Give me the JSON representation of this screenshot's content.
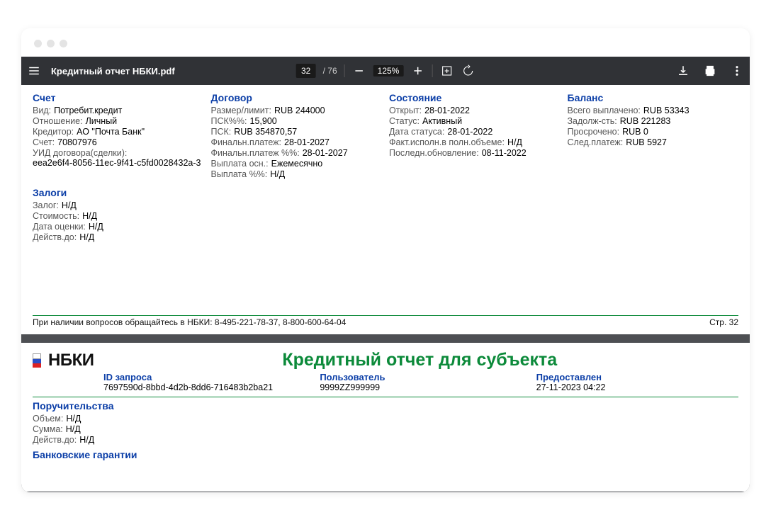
{
  "toolbar": {
    "filename": "Кредитный отчет НБКИ.pdf",
    "page_current": "32",
    "page_total": "/ 76",
    "zoom": "125%"
  },
  "page1": {
    "account": {
      "title": "Счет",
      "type_lbl": "Вид:",
      "type_val": "Потребит.кредит",
      "relation_lbl": "Отношение:",
      "relation_val": "Личный",
      "creditor_lbl": "Кредитор:",
      "creditor_val": "АО \"Почта Банк\"",
      "acct_lbl": "Счет:",
      "acct_val": "70807976",
      "uid_lbl": "УИД договора(сделки):",
      "uid_val": "eea2e6f4-8056-11ec-9f41-c5fd0028432a-3"
    },
    "contract": {
      "title": "Договор",
      "limit_lbl": "Размер/лимит:",
      "limit_val": "RUB 244000",
      "pskp_lbl": "ПСК%%:",
      "pskp_val": "15,900",
      "psk_lbl": "ПСК:",
      "psk_val": "RUB 354870,57",
      "final_lbl": "Финальн.платеж:",
      "final_val": "28-01-2027",
      "finalp_lbl": "Финальн.платеж %%:",
      "finalp_val": "28-01-2027",
      "payout_lbl": "Выплата осн.:",
      "payout_val": "Ежемесячно",
      "payoutp_lbl": "Выплата %%:",
      "payoutp_val": "Н/Д"
    },
    "state": {
      "title": "Состояние",
      "open_lbl": "Открыт:",
      "open_val": "28-01-2022",
      "status_lbl": "Статус:",
      "status_val": "Активный",
      "status_date_lbl": "Дата статуса:",
      "status_date_val": "28-01-2022",
      "fact_lbl": "Факт.исполн.в полн.объеме:",
      "fact_val": "Н/Д",
      "update_lbl": "Последн.обновление:",
      "update_val": "08-11-2022"
    },
    "balance": {
      "title": "Баланс",
      "paid_lbl": "Всего выплачено:",
      "paid_val": "RUB 53343",
      "debt_lbl": "Задолж-сть:",
      "debt_val": "RUB 221283",
      "overdue_lbl": "Просрочено:",
      "overdue_val": "RUB 0",
      "next_lbl": "След.платеж:",
      "next_val": "RUB 5927"
    },
    "pledges": {
      "title": "Залоги",
      "pledge_lbl": "Залог:",
      "pledge_val": "Н/Д",
      "cost_lbl": "Стоимость:",
      "cost_val": "Н/Д",
      "eval_lbl": "Дата оценки:",
      "eval_val": "Н/Д",
      "valid_lbl": "Действ.до:",
      "valid_val": "Н/Д"
    },
    "footer_contact": "При наличии вопросов обращайтесь в НБКИ: 8-495-221-78-37, 8-800-600-64-04",
    "footer_page": "Стр. 32"
  },
  "page2": {
    "nbki": "НБКИ",
    "report_title": "Кредитный отчет для субъекта",
    "meta": {
      "request_id_lbl": "ID запроса",
      "request_id_val": "7697590d-8bbd-4d2b-8dd6-716483b2ba21",
      "user_lbl": "Пользователь",
      "user_val": "9999ZZ999999",
      "provided_lbl": "Предоставлен",
      "provided_val": "27-11-2023 04:22"
    },
    "guarantees": {
      "title": "Поручительства",
      "vol_lbl": "Объем:",
      "vol_val": "Н/Д",
      "sum_lbl": "Сумма:",
      "sum_val": "Н/Д",
      "valid_lbl": "Действ.до:",
      "valid_val": "Н/Д"
    },
    "bank_title": "Банковские гарантии"
  }
}
